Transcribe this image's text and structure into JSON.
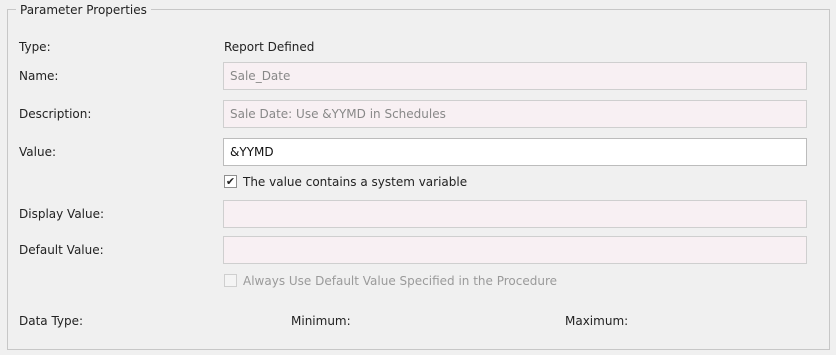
{
  "section": {
    "title": "Parameter Properties"
  },
  "type": {
    "label": "Type:",
    "value": "Report Defined"
  },
  "name": {
    "label": "Name:",
    "value": "Sale_Date"
  },
  "description": {
    "label": "Description:",
    "value": "Sale Date: Use &YYMD in Schedules"
  },
  "value": {
    "label": "Value:",
    "value": "&YYMD"
  },
  "system_variable_checkbox": {
    "label": "The value contains a system variable",
    "checked": true,
    "icon": "checkmark-icon",
    "glyph": "✔"
  },
  "display_value": {
    "label": "Display Value:",
    "value": ""
  },
  "default_value": {
    "label": "Default Value:",
    "value": ""
  },
  "always_use_default_checkbox": {
    "label": "Always Use Default Value Specified in the Procedure",
    "checked": false,
    "disabled": true
  },
  "data_type": {
    "label": "Data Type:"
  },
  "minimum": {
    "label": "Minimum:"
  },
  "maximum": {
    "label": "Maximum:"
  },
  "colors": {
    "readonly_field_bg": "#f8f0f3",
    "editable_field_bg": "#ffffff",
    "panel_bg": "#f0f0f0"
  }
}
